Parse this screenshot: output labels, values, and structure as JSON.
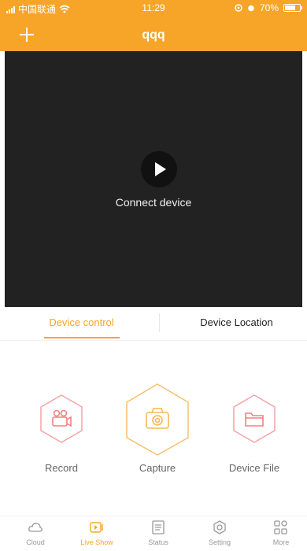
{
  "status_bar": {
    "carrier": "中国联通",
    "time": "11:29",
    "battery": "70%",
    "battery_level": 0.7
  },
  "header": {
    "title": "qqq",
    "add_icon": "plus-icon"
  },
  "player": {
    "play_icon": "play-icon",
    "connect_label": "Connect device"
  },
  "tabs": [
    {
      "label": "Device control",
      "active": true
    },
    {
      "label": "Device Location",
      "active": false
    }
  ],
  "actions": [
    {
      "label": "Record",
      "icon": "video-camera-icon",
      "color": "#f08080"
    },
    {
      "label": "Capture",
      "icon": "camera-icon",
      "color": "#f7b955"
    },
    {
      "label": "Device File",
      "icon": "folder-icon",
      "color": "#f08080"
    }
  ],
  "bottom_nav": [
    {
      "label": "Cloud",
      "icon": "cloud-icon",
      "active": false
    },
    {
      "label": "Live Show",
      "icon": "live-play-icon",
      "active": true
    },
    {
      "label": "Status",
      "icon": "status-list-icon",
      "active": false
    },
    {
      "label": "Setting",
      "icon": "settings-icon",
      "active": false
    },
    {
      "label": "More",
      "icon": "grid-more-icon",
      "active": false
    }
  ],
  "colors": {
    "accent": "#f7a529",
    "video_bg": "#222222"
  }
}
